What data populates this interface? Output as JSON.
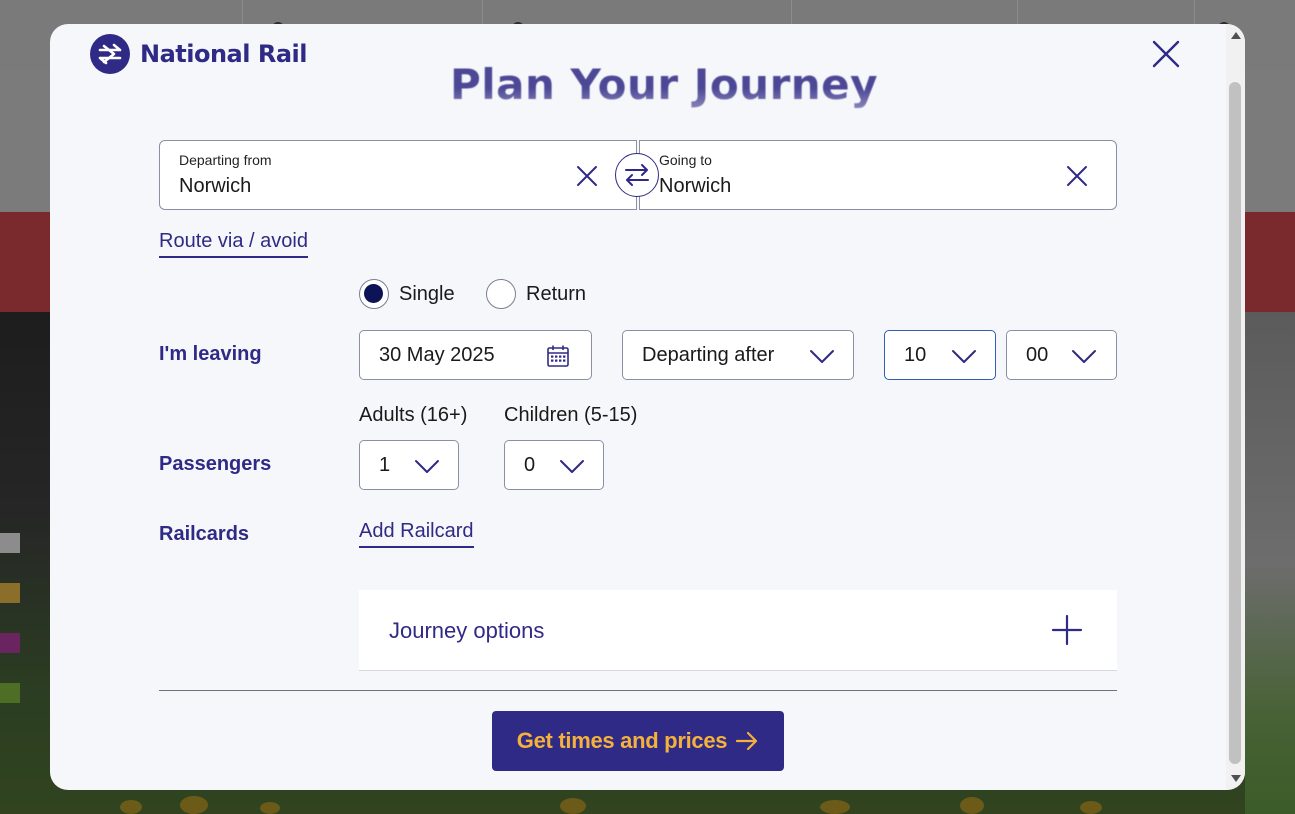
{
  "colors": {
    "brand": "#2f2a85",
    "cta_text": "#f5b13b",
    "radio_checked": "#0c1356",
    "focus_border": "#2f5fb3"
  },
  "brand": {
    "logo_icon": "national-rail-double-arrow-logo",
    "name": "National Rail"
  },
  "modal": {
    "title": "Plan Your Journey",
    "close_icon": "close-icon"
  },
  "stations": {
    "from": {
      "label": "Departing from",
      "value": "Norwich",
      "clear_icon": "close-icon"
    },
    "to": {
      "label": "Going to",
      "value": "Norwich",
      "clear_icon": "close-icon"
    },
    "swap_icon": "swap-arrows-icon"
  },
  "route_link": "Route via / avoid",
  "ticket_type": {
    "options": [
      {
        "label": "Single",
        "selected": true
      },
      {
        "label": "Return",
        "selected": false
      }
    ]
  },
  "leaving": {
    "label": "I'm leaving",
    "date": "30 May 2025",
    "date_icon": "calendar-icon",
    "time_mode": "Departing after",
    "hour": "10",
    "minute": "00"
  },
  "passengers": {
    "label": "Passengers",
    "adults_label": "Adults (16+)",
    "adults": "1",
    "children_label": "Children (5-15)",
    "children": "0"
  },
  "railcards": {
    "label": "Railcards",
    "add_link": "Add Railcard"
  },
  "journey_options": {
    "label": "Journey options",
    "icon": "plus-icon"
  },
  "cta": {
    "label": "Get times and prices",
    "icon": "arrow-right-icon"
  }
}
